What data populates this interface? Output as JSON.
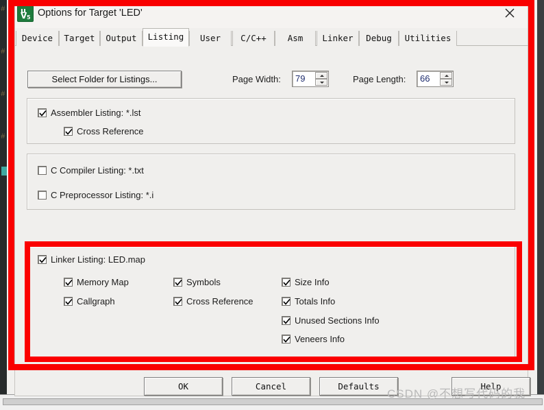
{
  "window": {
    "title": "Options for Target 'LED'",
    "icon": "keil-uvision-icon",
    "close_label": "×"
  },
  "tabs": [
    {
      "label": "Device",
      "active": false
    },
    {
      "label": "Target",
      "active": false
    },
    {
      "label": "Output",
      "active": false
    },
    {
      "label": "Listing",
      "active": true
    },
    {
      "label": "User",
      "active": false
    },
    {
      "label": "C/C++",
      "active": false
    },
    {
      "label": "Asm",
      "active": false
    },
    {
      "label": "Linker",
      "active": false
    },
    {
      "label": "Debug",
      "active": false
    },
    {
      "label": "Utilities",
      "active": false
    }
  ],
  "toolbar": {
    "select_folder_label": "Select Folder for Listings...",
    "page_width_label": "Page Width:",
    "page_width_value": "79",
    "page_length_label": "Page Length:",
    "page_length_value": "66"
  },
  "assembler_group": {
    "assembler_listing": {
      "label": "Assembler Listing:  *.lst",
      "checked": true
    },
    "cross_reference": {
      "label": "Cross Reference",
      "checked": true
    }
  },
  "compiler_group": {
    "c_compiler_listing": {
      "label": "C Compiler Listing:  *.txt",
      "checked": false
    },
    "c_preprocessor_listing": {
      "label": "C Preprocessor Listing:  *.i",
      "checked": false
    }
  },
  "linker_group": {
    "linker_listing": {
      "label": "Linker Listing:  LED.map",
      "checked": true
    },
    "col1": [
      {
        "label": "Memory Map",
        "checked": true
      },
      {
        "label": "Callgraph",
        "checked": true
      }
    ],
    "col2": [
      {
        "label": "Symbols",
        "checked": true
      },
      {
        "label": "Cross Reference",
        "checked": true
      }
    ],
    "col3": [
      {
        "label": "Size Info",
        "checked": true
      },
      {
        "label": "Totals Info",
        "checked": true
      },
      {
        "label": "Unused Sections Info",
        "checked": true
      },
      {
        "label": "Veneers Info",
        "checked": true
      }
    ]
  },
  "footer": {
    "ok": "OK",
    "cancel": "Cancel",
    "defaults": "Defaults",
    "help": "Help"
  },
  "annotation": {
    "outer_highlight_color": "#f90000",
    "inner_highlight_color": "#fb0000"
  },
  "watermark": {
    "text": "CSDN @不想写代码的我"
  }
}
